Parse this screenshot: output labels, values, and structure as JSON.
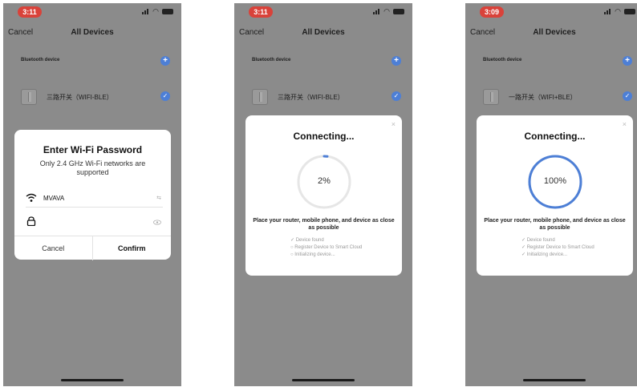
{
  "screens": [
    {
      "time": "3:11",
      "nav": {
        "cancel": "Cancel",
        "title": "All Devices"
      },
      "section_label": "Bluetooth device",
      "device_name": "三路开关（WIFI-BLE）",
      "dialog": {
        "title": "Enter Wi-Fi Password",
        "subtitle": "Only 2.4 GHz Wi-Fi networks are supported",
        "ssid": "MVAVA",
        "ssid_end": "⇆",
        "password": "",
        "cancel": "Cancel",
        "confirm": "Confirm"
      }
    },
    {
      "time": "3:11",
      "nav": {
        "cancel": "Cancel",
        "title": "All Devices"
      },
      "section_label": "Bluetooth device",
      "device_name": "三路开关（WIFI-BLE）",
      "connecting": {
        "close": "×",
        "title": "Connecting...",
        "progress_text": "2%",
        "progress": 0.02,
        "message": "Place your router, mobile phone, and device as close as possible",
        "steps": [
          "✓ Device found",
          "○ Register Device to Smart Cloud",
          "○ Initializing device..."
        ]
      }
    },
    {
      "time": "3:09",
      "nav": {
        "cancel": "Cancel",
        "title": "All Devices"
      },
      "section_label": "Bluetooth device",
      "device_name": "一路开关（WIFI+BLE）",
      "connecting": {
        "close": "×",
        "title": "Connecting...",
        "progress_text": "100%",
        "progress": 1.0,
        "message": "Place your router, mobile phone, and device as close as possible",
        "steps": [
          "✓ Device found",
          "✓ Register Device to Smart Cloud",
          "✓ Initializing device..."
        ]
      }
    }
  ],
  "colors": {
    "accent": "#4d7fd6",
    "time_pill": "#d9423a",
    "overlay": "#8b8b8b",
    "ring_track": "#e6e6e6"
  },
  "icons": [
    "plus-icon",
    "check-icon",
    "wifi-icon",
    "lock-icon",
    "eye-icon",
    "close-icon",
    "switch-device-icon"
  ]
}
